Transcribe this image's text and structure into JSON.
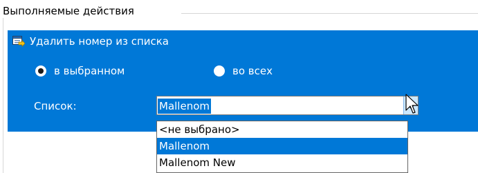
{
  "group": {
    "title": "Выполняемые действия"
  },
  "action": {
    "title": "Удалить номер из списка",
    "icon": "delete-from-list-icon"
  },
  "scope": {
    "options": [
      {
        "label": "в выбранном",
        "selected": true
      },
      {
        "label": "во всех",
        "selected": false
      }
    ]
  },
  "list": {
    "label": "Список:",
    "value": "Mallenom",
    "options": [
      "<не выбрано>",
      "Mallenom",
      "Mallenom New"
    ],
    "selected_index": 1
  },
  "colors": {
    "panel": "#0078d7",
    "selection": "#0078d7",
    "arrow_button_hover": "#cce8ff"
  }
}
